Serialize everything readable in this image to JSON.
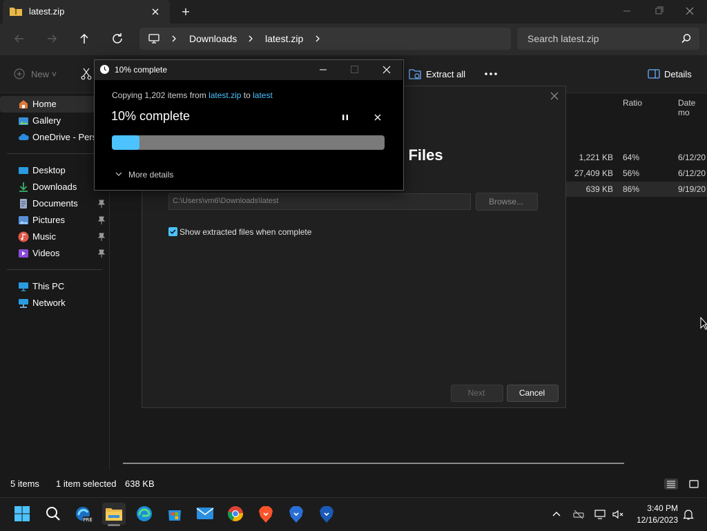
{
  "window": {
    "tab_title": "latest.zip",
    "new_tab": "+"
  },
  "address": {
    "crumbs": [
      "Downloads",
      "latest.zip"
    ],
    "search_placeholder": "Search latest.zip"
  },
  "toolbar": {
    "new_label": "New",
    "extract_label": "Extract all",
    "details_label": "Details"
  },
  "sidebar": {
    "items": [
      {
        "label": "Home",
        "icon": "home-icon",
        "pinned": false
      },
      {
        "label": "Gallery",
        "icon": "gallery-icon",
        "pinned": false
      },
      {
        "label": "OneDrive - Perso",
        "icon": "cloud-icon",
        "pinned": false
      },
      {
        "label": "Desktop",
        "icon": "desktop-icon",
        "pinned": false
      },
      {
        "label": "Downloads",
        "icon": "download-icon",
        "pinned": false
      },
      {
        "label": "Documents",
        "icon": "documents-icon",
        "pinned": true
      },
      {
        "label": "Pictures",
        "icon": "pictures-icon",
        "pinned": true
      },
      {
        "label": "Music",
        "icon": "music-icon",
        "pinned": true
      },
      {
        "label": "Videos",
        "icon": "videos-icon",
        "pinned": true
      },
      {
        "label": "This PC",
        "icon": "pc-icon",
        "pinned": false
      },
      {
        "label": "Network",
        "icon": "network-icon",
        "pinned": false
      }
    ]
  },
  "file_list": {
    "columns": {
      "ratio": "Ratio",
      "date": "Date mo"
    },
    "rows": [
      {
        "size": "1,221 KB",
        "ratio": "64%",
        "date": "6/12/20"
      },
      {
        "size": "27,409 KB",
        "ratio": "56%",
        "date": "6/12/20"
      },
      {
        "size": "639 KB",
        "ratio": "86%",
        "date": "9/19/20"
      }
    ]
  },
  "status": {
    "items": "5 items",
    "selected": "1 item selected",
    "size": "638 KB"
  },
  "wizard": {
    "title_fragment": "t Files",
    "path": "C:\\Users\\vm6\\Downloads\\latest",
    "browse_label": "Browse...",
    "checkbox_label": "Show extracted files when complete",
    "checkbox_checked": true,
    "next_label": "Next",
    "cancel_label": "Cancel"
  },
  "progress": {
    "window_title": "10% complete",
    "copy_prefix": "Copying 1,202 items from ",
    "source": "latest.zip",
    "copy_mid": " to ",
    "destination": "latest",
    "percent_label": "10% complete",
    "percent_value": 0.1,
    "more_details": "More details"
  },
  "clock": {
    "time": "3:40 PM",
    "date": "12/16/2023"
  },
  "colors": {
    "accent": "#4cc2ff",
    "background": "#191919",
    "progress_track": "#7a7a7a"
  }
}
